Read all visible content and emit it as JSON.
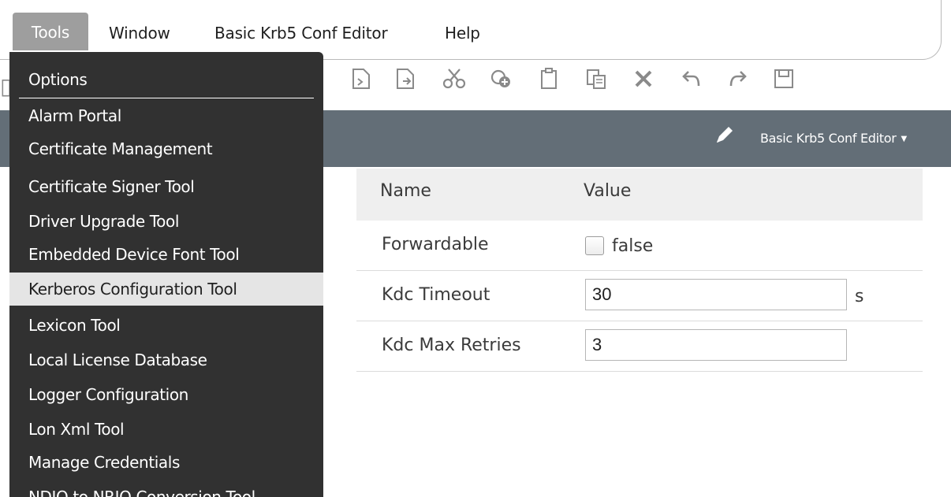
{
  "menubar": {
    "items": [
      "Tools",
      "Window",
      "Basic Krb5 Conf Editor",
      "Help"
    ]
  },
  "toolbar": {
    "icons": [
      "new-document-icon",
      "open-document-icon",
      "cut-icon",
      "copy-icon",
      "clipboard-icon",
      "paste-icon",
      "delete-icon",
      "undo-icon",
      "redo-icon",
      "save-icon"
    ]
  },
  "header": {
    "view_selector": "Basic Krb5 Conf Editor"
  },
  "property_sheet": {
    "columns": [
      "Name",
      "Value"
    ],
    "rows": [
      {
        "name": "Forwardable",
        "value": "false",
        "kind": "checkbox"
      },
      {
        "name": "Kdc Timeout",
        "value": "30",
        "unit": "s",
        "kind": "input"
      },
      {
        "name": "Kdc Max Retries",
        "value": "3",
        "kind": "input"
      }
    ]
  },
  "tools_menu": {
    "items": [
      "Options",
      "Alarm Portal",
      "Certificate Management",
      "Certificate Signer Tool",
      "Driver Upgrade Tool",
      "Embedded Device Font Tool",
      "Kerberos Configuration Tool",
      "Lexicon Tool",
      "Local License Database",
      "Logger Configuration",
      "Lon Xml Tool",
      "Manage Credentials",
      "NDIO to NRIO Conversion Tool"
    ],
    "selected": "Kerberos Configuration Tool"
  },
  "colors": {
    "menu_bg": "#313131",
    "header_band": "#636e77",
    "selected_item": "#e5e5e5",
    "tools_tab": "#9e9e9e"
  }
}
